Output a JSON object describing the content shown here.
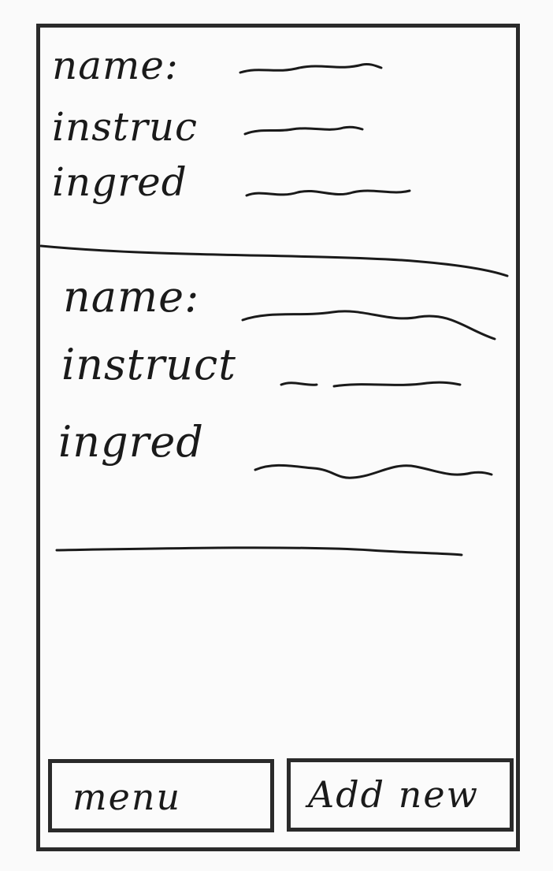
{
  "recipes": [
    {
      "name_label": "name:",
      "instructions_label": "instruc",
      "ingredients_label": "ingred"
    },
    {
      "name_label": "name:",
      "instructions_label": "instruct",
      "ingredients_label": "ingred"
    }
  ],
  "footer": {
    "menu_label": "menu",
    "add_new_label": "Add new"
  },
  "colors": {
    "ink": "#1a1a1a",
    "paper": "#fbfbfb",
    "border": "#2a2a2a"
  }
}
